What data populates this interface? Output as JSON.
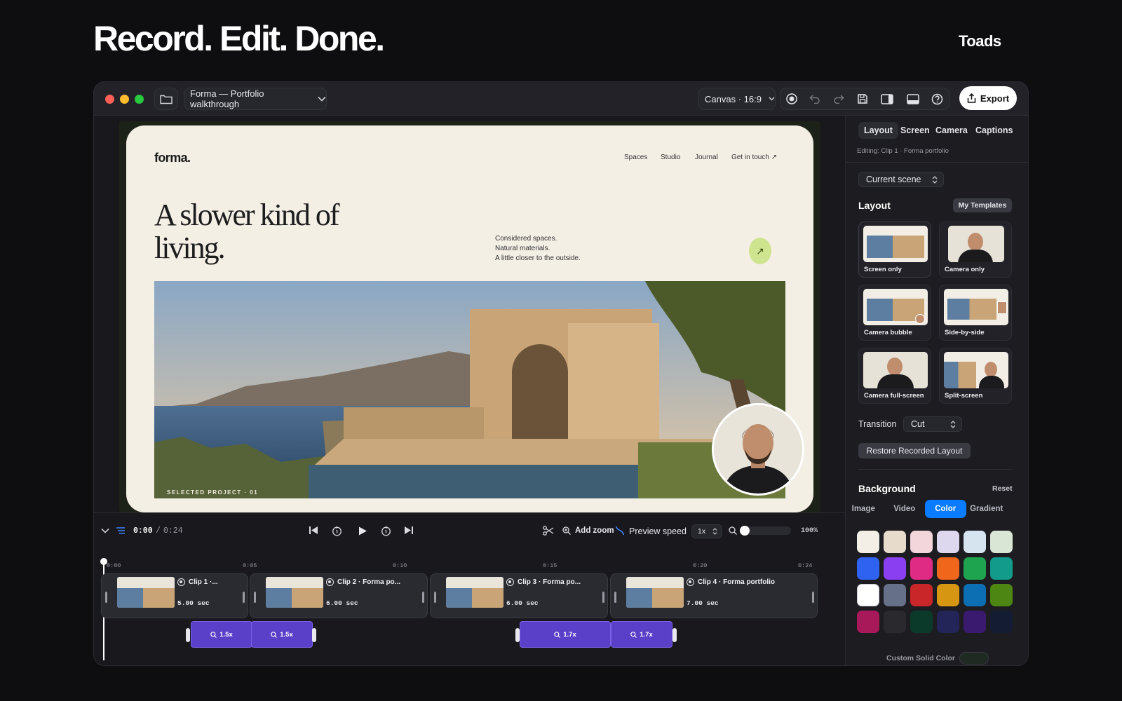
{
  "hero": {
    "title": "Record. Edit. Done.",
    "brand": "Toads"
  },
  "window": {
    "project_title": "Forma — Portfolio walkthrough",
    "canvas_label": "Canvas · 16:9",
    "export_label": "Export",
    "traffic_colors": [
      "#ff5f57",
      "#febc2e",
      "#28c840"
    ]
  },
  "site": {
    "logo": "forma.",
    "nav": [
      "Spaces",
      "Studio",
      "Journal",
      "Get in touch ↗"
    ],
    "headline": "A slower kind of living.",
    "tagline": [
      "Considered spaces.",
      "Natural materials.",
      "A little closer to the outside."
    ],
    "arrow": "↗",
    "photo_label": "SELECTED PROJECT · 01"
  },
  "sidebar": {
    "tabs": [
      "Layout",
      "Screen",
      "Camera",
      "Captions"
    ],
    "editing": "Editing: Clip 1 · Forma portfolio",
    "scene_select": "Current scene",
    "layout_title": "Layout",
    "my_templates": "My Templates",
    "templates": [
      "Screen only",
      "Camera only",
      "Camera bubble",
      "Side-by-side",
      "Camera full-screen",
      "Split-screen"
    ],
    "transition_label": "Transition",
    "transition_value": "Cut",
    "restore_label": "Restore Recorded Layout",
    "background_title": "Background",
    "reset_label": "Reset",
    "bg_tabs": [
      "Image",
      "Video",
      "Color",
      "Gradient"
    ],
    "bg_active": "Color",
    "swatches": [
      "#f3efe6",
      "#e7dccb",
      "#f2d6dc",
      "#ded8ef",
      "#d6e4f0",
      "#d9e6d6",
      "#2f62f0",
      "#8a3ff0",
      "#e02b84",
      "#f0661a",
      "#1ea44f",
      "#129a8a",
      "#ffffff",
      "#667089",
      "#c9262a",
      "#d79611",
      "#0c6fb4",
      "#4d8612",
      "#a8195a",
      "#2a2a2e",
      "#0b3a2a",
      "#232457",
      "#3a1a6e",
      "#141c34"
    ],
    "custom_color_label": "Custom Solid Color"
  },
  "timeline": {
    "current": "0:00",
    "total": "0:24",
    "add_zoom": "Add zoom",
    "preview_speed": "Preview speed",
    "speed": "1x",
    "zoom_pct": "100%",
    "ticks": [
      "0:00",
      "0:05",
      "0:10",
      "0:15",
      "0:20",
      "0:24"
    ],
    "clips": [
      {
        "title": "Clip 1 ·...",
        "duration": "5.00 sec"
      },
      {
        "title": "Clip 2 · Forma po...",
        "duration": "6.00 sec"
      },
      {
        "title": "Clip 3 · Forma po...",
        "duration": "6.00 sec"
      },
      {
        "title": "Clip 4 · Forma portfolio",
        "duration": "7.00 sec"
      }
    ],
    "zooms": [
      "1.5x",
      "1.5x",
      "1.7x",
      "1.7x"
    ]
  }
}
